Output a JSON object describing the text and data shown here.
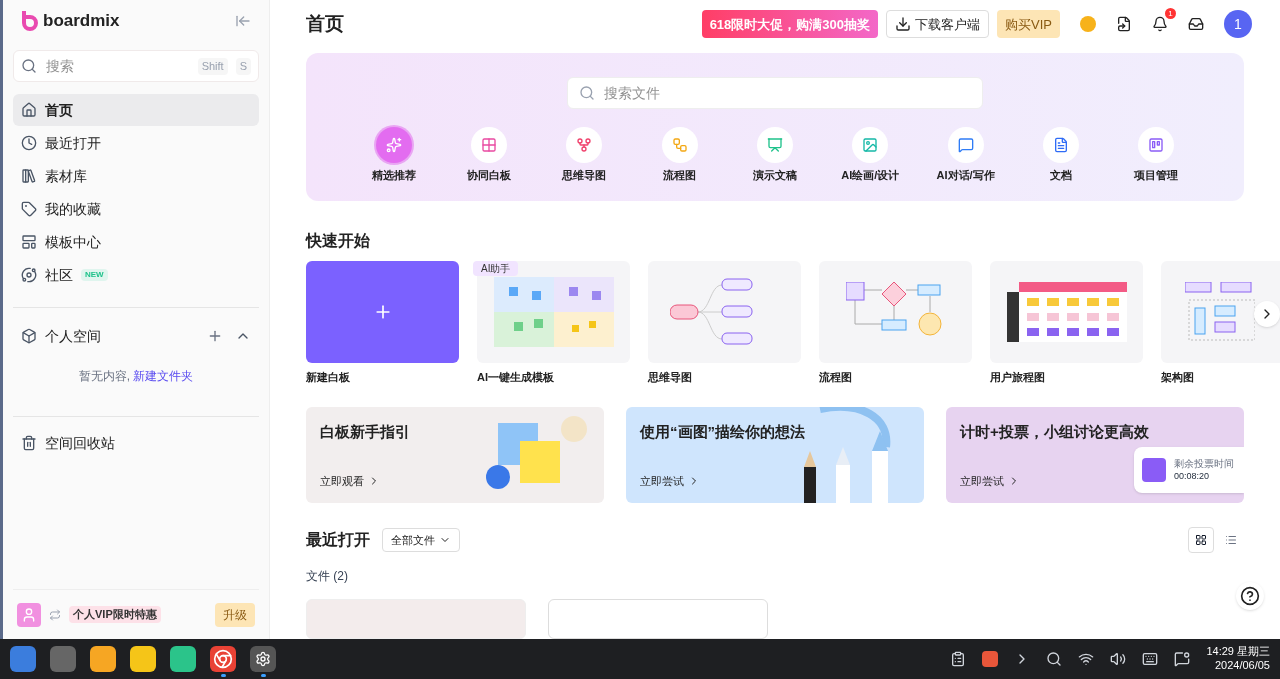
{
  "sidebar": {
    "logo": "boardmix",
    "search": {
      "placeholder": "搜索",
      "keys": [
        "Shift",
        "S"
      ]
    },
    "items": [
      {
        "label": "首页",
        "selected": true
      },
      {
        "label": "最近打开",
        "selected": false
      },
      {
        "label": "素材库",
        "selected": false
      },
      {
        "label": "我的收藏",
        "selected": false
      },
      {
        "label": "模板中心",
        "selected": false
      },
      {
        "label": "社区",
        "selected": false,
        "badge": "NEW"
      }
    ],
    "space": {
      "title": "个人空间",
      "expanded": true,
      "empty_text": "暂无内容,",
      "create_link": "新建文件夹"
    },
    "trash": "空间回收站",
    "promo": "个人VIP限时特惠",
    "upgrade": "升级"
  },
  "header": {
    "title": "首页",
    "promo": "618限时大促，购满300抽奖",
    "download": "下载客户端",
    "vip": "购买VIP",
    "notifications": "1",
    "avatar": "1"
  },
  "hero": {
    "search_placeholder": "搜索文件",
    "categories": [
      {
        "label": "精选推荐",
        "selected": true
      },
      {
        "label": "协同白板",
        "selected": false
      },
      {
        "label": "思维导图",
        "selected": false
      },
      {
        "label": "流程图",
        "selected": false
      },
      {
        "label": "演示文稿",
        "selected": false
      },
      {
        "label": "AI绘画/设计",
        "selected": false
      },
      {
        "label": "AI对话/写作",
        "selected": false
      },
      {
        "label": "文档",
        "selected": false
      },
      {
        "label": "项目管理",
        "selected": false
      }
    ]
  },
  "quick_start": {
    "title": "快速开始",
    "items": [
      {
        "kind": "new",
        "label": "新建白板"
      },
      {
        "kind": "ai",
        "label": "AI一键生成模板",
        "tag": "AI助手"
      },
      {
        "kind": "mindmap",
        "label": "思维导图"
      },
      {
        "kind": "flow",
        "label": "流程图"
      },
      {
        "kind": "journey",
        "label": "用户旅程图"
      },
      {
        "kind": "arch",
        "label": "架构图"
      }
    ]
  },
  "banners": [
    {
      "kind": "guide",
      "title": "白板新手指引",
      "action": "立即观看"
    },
    {
      "kind": "draw",
      "title": "使用“画图”描绘你的想法",
      "action": "立即尝试"
    },
    {
      "kind": "vote",
      "title": "计时+投票，小组讨论更高效",
      "action": "立即尝试",
      "timer_label": "剩余投票时间",
      "timer": "00:08:20"
    }
  ],
  "recent": {
    "title": "最近打开",
    "filter": "全部文件",
    "views": [
      {
        "selected": true
      },
      {
        "selected": false
      }
    ],
    "files_label": "文件 (2)"
  },
  "taskbar": {
    "apps": [
      {
        "running": false
      },
      {
        "running": false
      },
      {
        "running": false
      },
      {
        "running": false
      },
      {
        "running": false
      },
      {
        "running": true
      },
      {
        "running": true
      }
    ],
    "time": "14:29 星期三",
    "date": "2024/06/05"
  }
}
